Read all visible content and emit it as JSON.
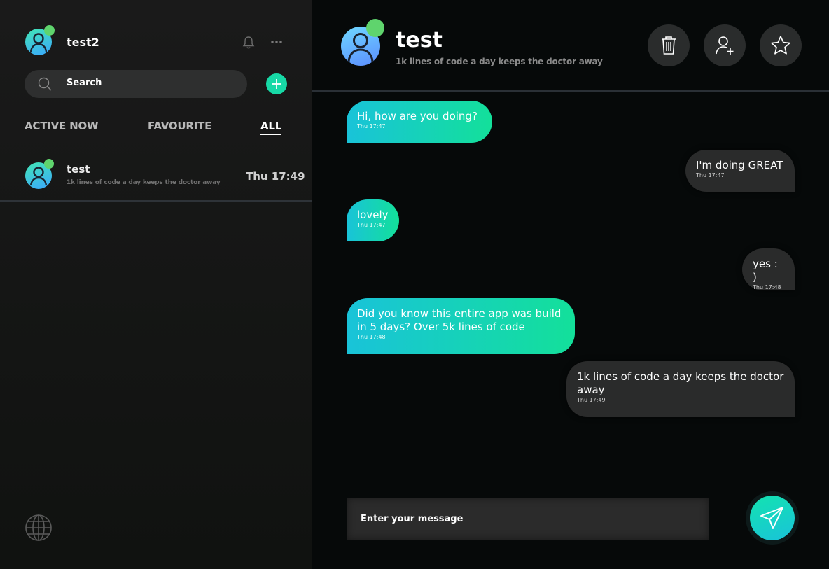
{
  "sidebar": {
    "user": {
      "name": "test2"
    },
    "search": {
      "label": "Search"
    },
    "tabs": [
      {
        "label": "ACTIVE NOW"
      },
      {
        "label": "FAVOURITE"
      },
      {
        "label": "ALL"
      }
    ],
    "contacts": [
      {
        "name": "test",
        "preview": "1k lines of code a day keeps the doctor away",
        "time": "Thu 17:49"
      }
    ],
    "icons": [
      "user-avatar-icon",
      "bell-icon",
      "more-dots-icon",
      "search-icon",
      "plus-icon",
      "globe-icon"
    ]
  },
  "chat": {
    "header": {
      "name": "test",
      "status": "1k lines of code a day keeps the doctor away",
      "actions": [
        "trash-icon",
        "add-user-icon",
        "star-icon"
      ]
    },
    "messages": [
      {
        "direction": "in",
        "text": "Hi, how are you doing?",
        "time": "Thu 17:47"
      },
      {
        "direction": "out",
        "text": "I'm doing GREAT",
        "time": "Thu 17:47"
      },
      {
        "direction": "in",
        "text": "lovely",
        "time": "Thu 17:47"
      },
      {
        "direction": "out",
        "text": "yes : )",
        "time": "Thu 17:48"
      },
      {
        "direction": "in",
        "text": "Did you know this entire app was build in 5 days? Over 5k lines of code",
        "time": "Thu 17:48"
      },
      {
        "direction": "out",
        "text": "1k lines of code a day keeps the doctor away",
        "time": "Thu 17:49"
      }
    ],
    "composer": {
      "placeholder": "Enter your message",
      "value": ""
    }
  },
  "colors": {
    "accent": "#17d9a6",
    "incoming_gradient_start": "#19c3d9",
    "incoming_gradient_end": "#13e09a",
    "outgoing_bubble": "#2a2b2b",
    "online": "#5fd46d",
    "background": "#050707"
  }
}
